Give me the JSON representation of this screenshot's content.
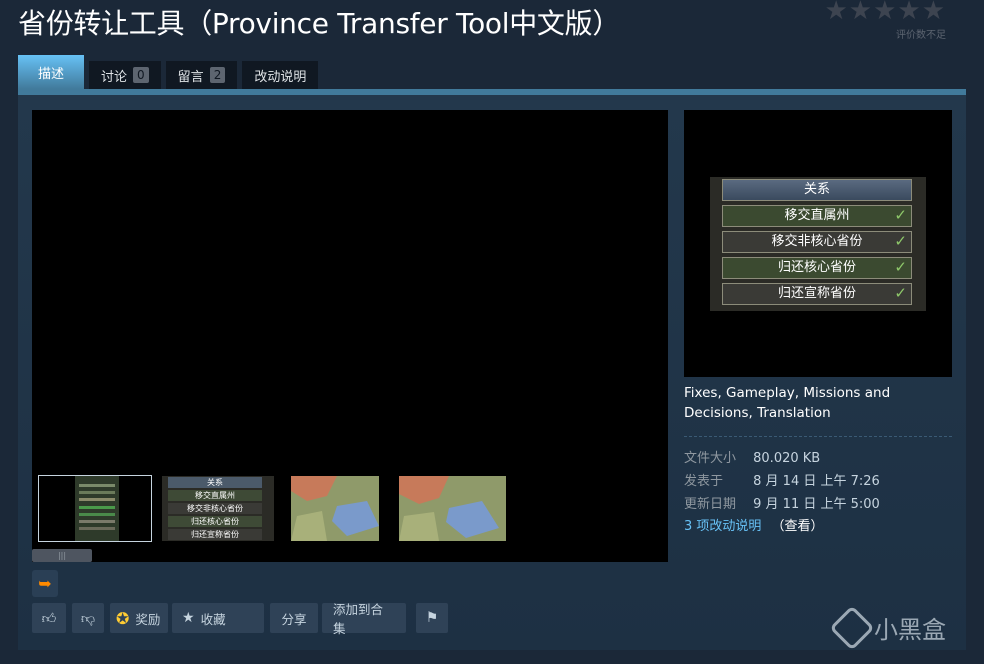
{
  "title": "省份转让工具（Province Transfer Tool中文版）",
  "rating": {
    "stars": "★★★★★",
    "text": "评价数不足"
  },
  "tabs": [
    {
      "label": "描述"
    },
    {
      "label": "讨论",
      "count": "0"
    },
    {
      "label": "留言",
      "count": "2"
    },
    {
      "label": "改动说明"
    }
  ],
  "relations_panel": {
    "header": "关系",
    "rows": [
      "移交直属州",
      "移交非核心省份",
      "归还核心省份",
      "归还宣称省份"
    ],
    "check": "✓"
  },
  "thumbnails": {
    "thumb2_rows": [
      "移交直属州",
      "移交非核心省份",
      "归还核心省份",
      "归还宣称省份"
    ],
    "thumb2_header": "关系"
  },
  "tags": "Fixes, Gameplay, Missions and Decisions, Translation",
  "meta": [
    {
      "key": "文件大小",
      "value": "80.020 KB"
    },
    {
      "key": "发表于",
      "value": "8 月 14 日 上午 7:26"
    },
    {
      "key": "更新日期",
      "value": "9 月 11 日 上午 5:00"
    }
  ],
  "changes": {
    "link": "3 项改动说明",
    "view": "（查看）"
  },
  "buttons": {
    "award": "奖励",
    "favorite": "收藏",
    "share": "分享",
    "add_to_collection": "添加到合集"
  },
  "icons": {
    "thumbs_up": "thumbs-up-icon",
    "thumbs_down": "thumbs-down-icon",
    "award": "award-icon",
    "star": "star-icon",
    "flag": "flag-icon",
    "orange_arrow": "arrow-icon"
  },
  "watermark": "小黑盒"
}
